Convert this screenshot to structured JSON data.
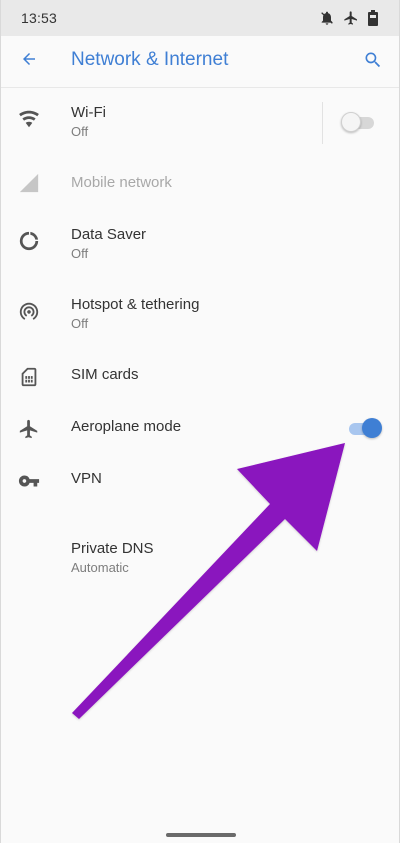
{
  "status_bar": {
    "time": "13:53",
    "icons": [
      "bell-off-icon",
      "airplane-icon",
      "battery-icon"
    ]
  },
  "app_bar": {
    "title": "Network & Internet",
    "back_icon": "back-arrow-icon",
    "search_icon": "search-icon",
    "accent_color": "#3f7fd4"
  },
  "settings": [
    {
      "id": "wifi",
      "title": "Wi-Fi",
      "subtitle": "Off",
      "icon": "wifi-icon",
      "toggle": "off",
      "enabled": true
    },
    {
      "id": "mobile-network",
      "title": "Mobile network",
      "subtitle": "",
      "icon": "cellular-signal-icon",
      "enabled": false
    },
    {
      "id": "data-saver",
      "title": "Data Saver",
      "subtitle": "Off",
      "icon": "data-saver-icon",
      "enabled": true
    },
    {
      "id": "hotspot",
      "title": "Hotspot & tethering",
      "subtitle": "Off",
      "icon": "hotspot-icon",
      "enabled": true
    },
    {
      "id": "sim-cards",
      "title": "SIM cards",
      "subtitle": "",
      "icon": "sim-card-icon",
      "enabled": true
    },
    {
      "id": "aeroplane-mode",
      "title": "Aeroplane mode",
      "subtitle": "",
      "icon": "airplane-icon",
      "toggle": "on",
      "enabled": true
    },
    {
      "id": "vpn",
      "title": "VPN",
      "subtitle": "",
      "icon": "vpn-key-icon",
      "enabled": true
    },
    {
      "id": "private-dns",
      "title": "Private DNS",
      "subtitle": "Automatic",
      "icon": "",
      "enabled": true
    }
  ],
  "annotation": {
    "type": "arrow",
    "color": "#8a12be"
  }
}
